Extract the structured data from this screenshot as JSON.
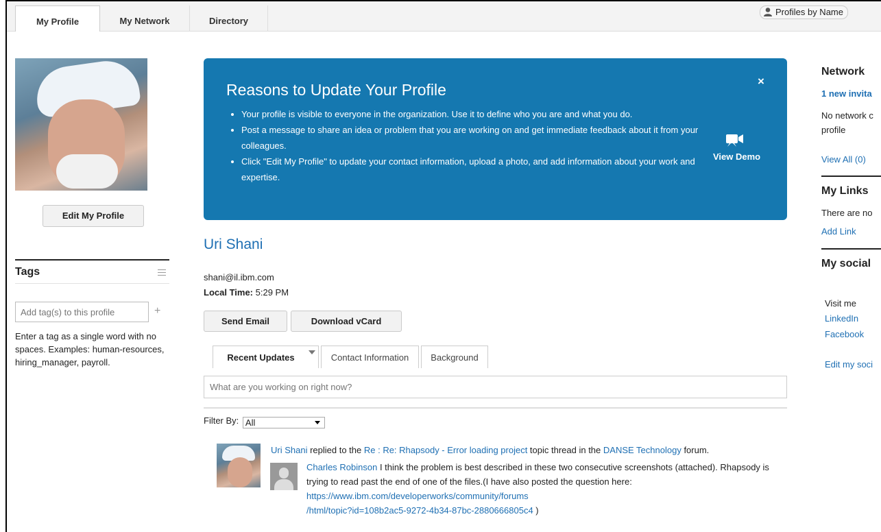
{
  "nav": {
    "tabs": [
      "My Profile",
      "My Network",
      "Directory"
    ],
    "profiles_by_name": "Profiles by Name"
  },
  "left": {
    "edit_button": "Edit My Profile",
    "tags_title": "Tags",
    "tag_placeholder": "Add tag(s) to this profile",
    "tag_add": "+",
    "tag_help": "Enter a tag as a single word with no spaces. Examples: human-resources, hiring_manager, payroll."
  },
  "banner": {
    "title": "Reasons to Update Your Profile",
    "bullets": [
      "Your profile is visible to everyone in the organization. Use it to define who you are and what you do.",
      "Post a message to share an idea or problem that you are working on and get immediate feedback about it from your colleagues.",
      "Click \"Edit My Profile\" to update your contact information, upload a photo, and add information about your work and expertise."
    ],
    "close": "×",
    "view_demo": "View Demo"
  },
  "profile": {
    "name": "Uri Shani",
    "email": "shani@il.ibm.com",
    "local_time_label": "Local Time:",
    "local_time_value": "5:29 PM",
    "send_email": "Send Email",
    "download_vcard": "Download vCard"
  },
  "tabs": [
    "Recent Updates",
    "Contact Information",
    "Background"
  ],
  "status_placeholder": "What are you working on right now?",
  "filter": {
    "label": "Filter By:",
    "value": "All"
  },
  "feed": {
    "actor": "Uri Shani",
    "text1": " replied to the ",
    "topic": "Re : Re: Rhapsody - Error loading project",
    "text2": " topic thread in the ",
    "forum": "DANSE Technology",
    "text3": " forum.",
    "reply_author": "Charles Robinson",
    "reply_text": " I think the problem is best described in these two consecutive screenshots (attached).  Rhapsody is trying to read past the end of one of the files.(I have also posted the question here: ",
    "reply_link_1": "https://www.ibm.com/developerworks/community/forums",
    "reply_link_2": "/html/topic?id=108b2ac5-9272-4b34-87bc-2880666805c4",
    "reply_end": " )"
  },
  "right": {
    "network_title": "Network",
    "invitation": "1 new invita",
    "no_network_1": "No network c",
    "no_network_2": "profile",
    "view_all": "View All (0)",
    "links_title": "My Links",
    "links_none": "There are no",
    "add_link": "Add Link",
    "social_title": "My social",
    "visit_me": "Visit me",
    "linkedin": "LinkedIn",
    "facebook": "Facebook",
    "edit_social": "Edit my soci"
  }
}
